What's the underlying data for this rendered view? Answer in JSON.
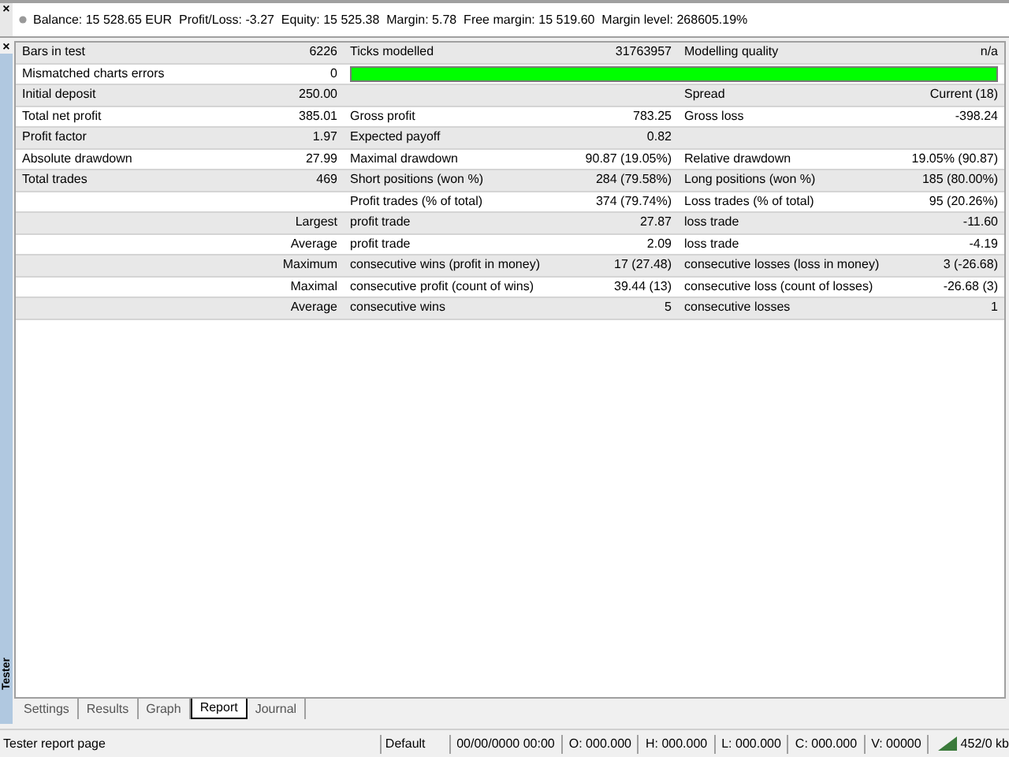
{
  "account_bar": {
    "close": "×",
    "text": "Balance: 15 528.65 EUR  Profit/Loss: -3.27  Equity: 15 525.38  Margin: 5.78  Free margin: 15 519.60  Margin level: 268605.19%"
  },
  "side_panel": {
    "close": "×",
    "title": "Tester"
  },
  "report": {
    "rows": [
      {
        "kind": "plain",
        "cells": [
          "Bars in test",
          "6226",
          "Ticks modelled",
          "31763957",
          "Modelling quality",
          "n/a"
        ]
      },
      {
        "kind": "bar",
        "cells": [
          "Mismatched charts errors",
          "0"
        ],
        "level": 1
      },
      {
        "kind": "plain",
        "cells": [
          "Initial deposit",
          "250.00",
          "",
          "",
          "Spread",
          "Current (18)"
        ]
      },
      {
        "kind": "plain",
        "cells": [
          "Total net profit",
          "385.01",
          "Gross profit",
          "783.25",
          "Gross loss",
          "-398.24"
        ]
      },
      {
        "kind": "plain",
        "cells": [
          "Profit factor",
          "1.97",
          "Expected payoff",
          "0.82",
          "",
          ""
        ]
      },
      {
        "kind": "plain",
        "cells": [
          "Absolute drawdown",
          "27.99",
          "Maximal drawdown",
          "90.87 (19.05%)",
          "Relative drawdown",
          "19.05% (90.87)"
        ]
      },
      {
        "kind": "plain",
        "cells": [
          "Total trades",
          "469",
          "Short positions (won %)",
          "284 (79.58%)",
          "Long positions (won %)",
          "185 (80.00%)"
        ]
      },
      {
        "kind": "detail",
        "cells": [
          "",
          "",
          "Profit trades (% of total)",
          "374 (79.74%)",
          "Loss trades (% of total)",
          "95 (20.26%)"
        ]
      },
      {
        "kind": "detail",
        "cells": [
          "",
          "Largest",
          "profit trade",
          "27.87",
          "loss trade",
          "-11.60"
        ]
      },
      {
        "kind": "detail",
        "cells": [
          "",
          "Average",
          "profit trade",
          "2.09",
          "loss trade",
          "-4.19"
        ]
      },
      {
        "kind": "detail",
        "cells": [
          "",
          "Maximum",
          "consecutive wins (profit in money)",
          "17 (27.48)",
          "consecutive losses (loss in money)",
          "3 (-26.68)"
        ]
      },
      {
        "kind": "detail",
        "cells": [
          "",
          "Maximal",
          "consecutive profit (count of wins)",
          "39.44 (13)",
          "consecutive loss (count of losses)",
          "-26.68 (3)"
        ]
      },
      {
        "kind": "detail",
        "cells": [
          "",
          "Average",
          "consecutive wins",
          "5",
          "consecutive losses",
          "1"
        ]
      }
    ]
  },
  "tabs": [
    {
      "label": "Settings",
      "selected": false
    },
    {
      "label": "Results",
      "selected": false
    },
    {
      "label": "Graph",
      "selected": false
    },
    {
      "label": "Report",
      "selected": true
    },
    {
      "label": "Journal",
      "selected": false
    }
  ],
  "status_bar": {
    "message": "Tester report page",
    "profile": "Default",
    "fields": [
      "00/00/0000 00:00",
      "O: 000.000",
      "H: 000.000",
      "L: 000.000",
      "C: 000.000",
      "V: 00000"
    ],
    "traffic": "452/0 kb"
  }
}
